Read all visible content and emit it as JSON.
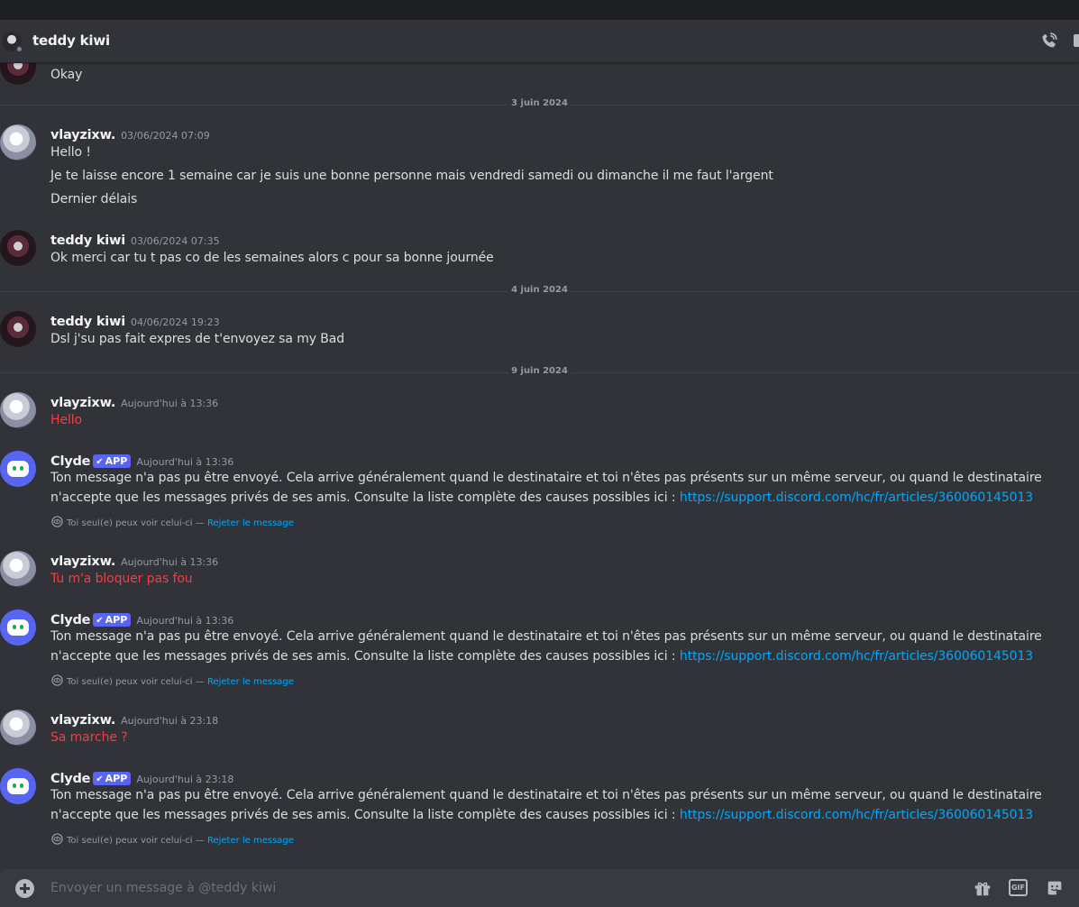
{
  "header": {
    "title": "teddy kiwi"
  },
  "dividers": [
    "3 juin 2024",
    "4 juin 2024",
    "9 juin 2024"
  ],
  "messages": {
    "m0": {
      "lines": [
        "Okay"
      ]
    },
    "m1": {
      "author": "vlayzixw.",
      "time": "03/06/2024 07:09",
      "lines": [
        "Hello !",
        "Je te laisse encore 1 semaine car je suis une bonne personne mais vendredi samedi ou dimanche il me faut l'argent",
        "Dernier délais"
      ]
    },
    "m2": {
      "author": "teddy kiwi",
      "time": "03/06/2024 07:35",
      "lines": [
        "Ok merci car tu t pas co de les semaines alors c pour sa bonne journée"
      ]
    },
    "m3": {
      "author": "teddy kiwi",
      "time": "04/06/2024 19:23",
      "lines": [
        "Dsl j'su pas fait expres de t'envoyez sa my Bad"
      ]
    },
    "m4": {
      "author": "vlayzixw.",
      "time": "Aujourd'hui à 13:36",
      "lines": [
        "Hello"
      ]
    },
    "m5": {
      "author": "Clyde",
      "badge": "APP",
      "time": "Aujourd'hui à 13:36"
    },
    "m6": {
      "author": "vlayzixw.",
      "time": "Aujourd'hui à 13:36",
      "lines": [
        "Tu m'a bloquer pas fou"
      ]
    },
    "m7": {
      "author": "Clyde",
      "badge": "APP",
      "time": "Aujourd'hui à 13:36"
    },
    "m8": {
      "author": "vlayzixw.",
      "time": "Aujourd'hui à 23:18",
      "lines": [
        "Sa marche ?"
      ]
    },
    "m9": {
      "author": "Clyde",
      "badge": "APP",
      "time": "Aujourd'hui à 23:18"
    }
  },
  "clyde": {
    "text": "Ton message n'a pas pu être envoyé. Cela arrive généralement quand le destinataire et toi n'êtes pas présents sur un même serveur, ou quand le destinataire n'accepte que les messages privés de ses amis. Consulte la liste complète des causes possibles ici : ",
    "link": "https://support.discord.com/hc/fr/articles/360060145013",
    "only_you": "Toi seul(e) peux voir celui-ci — ",
    "dismiss": "Rejeter le message"
  },
  "composer": {
    "placeholder": "Envoyer un message à @teddy kiwi",
    "gif_label": "GIF"
  },
  "colors": {
    "background": "#313338",
    "failed_text": "#f23f42",
    "link": "#00a8fc",
    "app_badge": "#5865f2"
  },
  "icons": [
    "phone-call-icon",
    "video-icon",
    "add-attachment-icon",
    "gift-icon",
    "gif-icon",
    "sticker-icon",
    "eye-icon",
    "check-icon"
  ]
}
